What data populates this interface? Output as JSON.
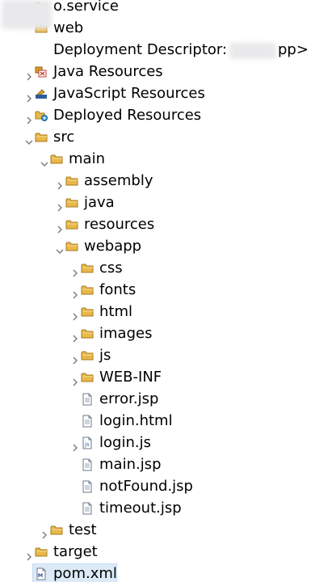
{
  "tree": {
    "rows": [
      {
        "label": "o.service",
        "icon": "project-icon",
        "twisty": "none",
        "indent": 0
      },
      {
        "label": "web",
        "icon": "project-icon",
        "twisty": "none",
        "indent": 0
      },
      {
        "label": "Deployment Descriptor: ",
        "label_suffix": "pp>",
        "redacted": true,
        "icon": "none",
        "twisty": "none",
        "indent": 0
      },
      {
        "label": "Java Resources",
        "icon": "java-resources-icon",
        "twisty": "collapsed",
        "indent": 0
      },
      {
        "label": "JavaScript Resources",
        "icon": "javascript-resources-icon",
        "twisty": "collapsed",
        "indent": 0
      },
      {
        "label": "Deployed Resources",
        "icon": "deployed-resources-icon",
        "twisty": "collapsed",
        "indent": 0
      },
      {
        "label": "src",
        "icon": "folder-icon",
        "twisty": "expanded",
        "indent": 0
      },
      {
        "label": "main",
        "icon": "folder-icon",
        "twisty": "expanded",
        "indent": 1
      },
      {
        "label": "assembly",
        "icon": "folder-icon",
        "twisty": "collapsed",
        "indent": 2
      },
      {
        "label": "java",
        "icon": "folder-icon",
        "twisty": "collapsed",
        "indent": 2
      },
      {
        "label": "resources",
        "icon": "folder-icon",
        "twisty": "collapsed",
        "indent": 2
      },
      {
        "label": "webapp",
        "icon": "folder-icon",
        "twisty": "expanded",
        "indent": 2
      },
      {
        "label": "css",
        "icon": "folder-icon",
        "twisty": "collapsed",
        "indent": 3
      },
      {
        "label": "fonts",
        "icon": "folder-icon",
        "twisty": "collapsed",
        "indent": 3
      },
      {
        "label": "html",
        "icon": "folder-icon",
        "twisty": "collapsed",
        "indent": 3
      },
      {
        "label": "images",
        "icon": "folder-icon",
        "twisty": "collapsed",
        "indent": 3
      },
      {
        "label": "js",
        "icon": "folder-icon",
        "twisty": "collapsed",
        "indent": 3
      },
      {
        "label": "WEB-INF",
        "icon": "folder-icon",
        "twisty": "collapsed",
        "indent": 3
      },
      {
        "label": "error.jsp",
        "icon": "file-icon",
        "twisty": "none",
        "indent": 3
      },
      {
        "label": "login.html",
        "icon": "file-icon",
        "twisty": "none",
        "indent": 3
      },
      {
        "label": "login.js",
        "icon": "js-file-icon",
        "twisty": "collapsed",
        "indent": 3
      },
      {
        "label": "main.jsp",
        "icon": "file-icon",
        "twisty": "none",
        "indent": 3
      },
      {
        "label": "notFound.jsp",
        "icon": "file-icon",
        "twisty": "none",
        "indent": 3
      },
      {
        "label": "timeout.jsp",
        "icon": "file-icon",
        "twisty": "none",
        "indent": 3
      },
      {
        "label": "test",
        "icon": "folder-icon",
        "twisty": "collapsed",
        "indent": 1
      },
      {
        "label": "target",
        "icon": "folder-icon",
        "twisty": "collapsed",
        "indent": 0
      },
      {
        "label": "pom.xml",
        "icon": "xml-file-icon",
        "twisty": "none",
        "indent": 0,
        "selected": true
      }
    ]
  },
  "colors": {
    "folder": "#e8b84a",
    "folder_stroke": "#a87a1c",
    "twisty": "#7a7a7a",
    "selection": "#dceaf7"
  }
}
